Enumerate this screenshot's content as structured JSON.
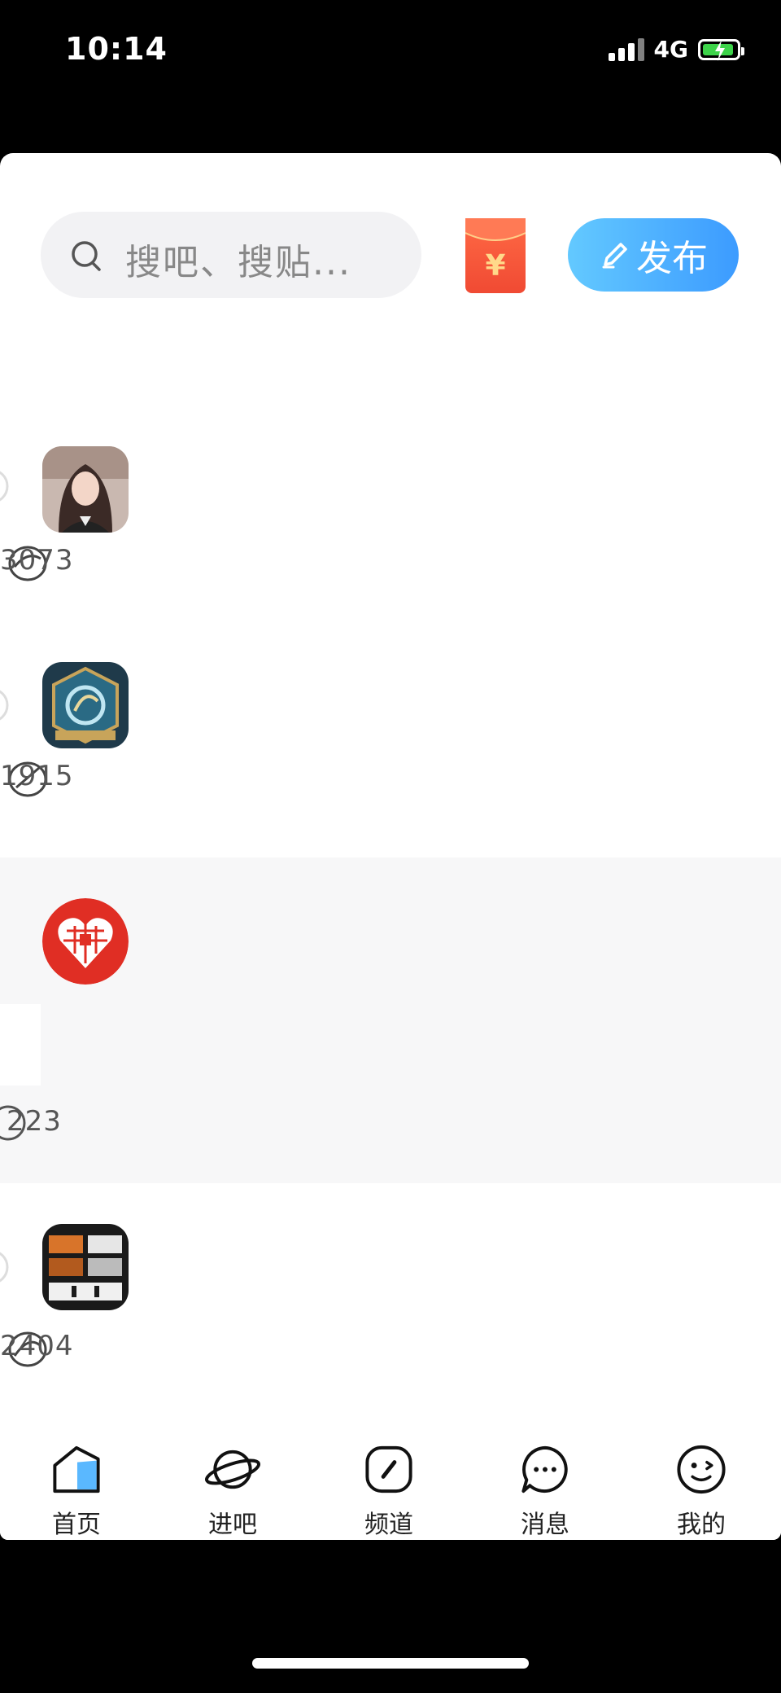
{
  "status_bar": {
    "time": "10:14",
    "network": "4G"
  },
  "header": {
    "search_placeholder": "搜吧、搜贴...",
    "publish_label": "发布",
    "redpacket_symbol": "¥"
  },
  "list": {
    "rows": [
      {
        "count": "3073",
        "avatar": "portrait-photo"
      },
      {
        "count": "1915",
        "avatar": "game-emblem"
      },
      {
        "count": "223",
        "avatar": "pinduoduo-logo"
      },
      {
        "count": "2404",
        "avatar": "game-badge"
      }
    ]
  },
  "tabbar": {
    "items": [
      {
        "label": "首页",
        "icon": "home-icon"
      },
      {
        "label": "进吧",
        "icon": "planet-icon"
      },
      {
        "label": "频道",
        "icon": "compass-icon"
      },
      {
        "label": "消息",
        "icon": "message-icon"
      },
      {
        "label": "我的",
        "icon": "smiley-icon"
      }
    ]
  },
  "colors": {
    "accent": "#3c9bff",
    "redpacket": "#f04a33",
    "highlight_row": "#f7f7f8"
  }
}
